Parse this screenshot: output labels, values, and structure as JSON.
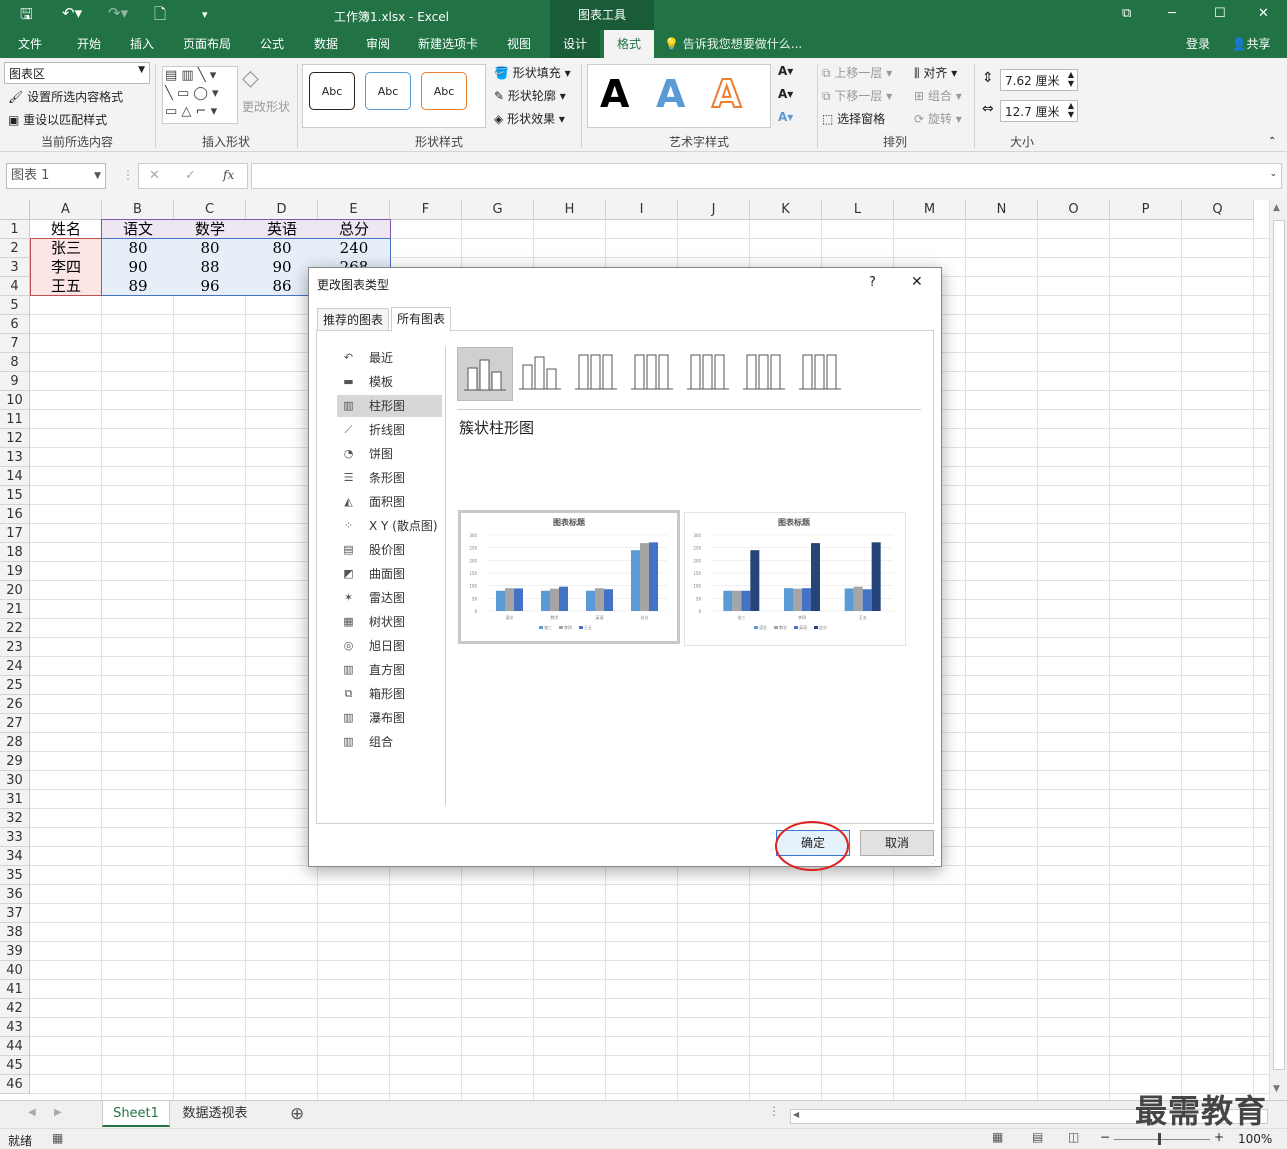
{
  "title_bar": {
    "file_title": "工作簿1.xlsx - Excel",
    "context_tools": "图表工具"
  },
  "tabs": [
    "文件",
    "开始",
    "插入",
    "页面布局",
    "公式",
    "数据",
    "审阅",
    "新建选项卡",
    "视图",
    "设计",
    "格式"
  ],
  "tell_me": "告诉我您想要做什么...",
  "account": {
    "login": "登录",
    "share": "共享"
  },
  "ribbon": {
    "current_selection": {
      "dropdown": "图表区",
      "format_selection": "设置所选内容格式",
      "reset_style": "重设以匹配样式",
      "label": "当前所选内容"
    },
    "insert_shapes": {
      "change_shape": "更改形状",
      "label": "插入形状"
    },
    "shape_styles": {
      "abc": "Abc",
      "fill": "形状填充",
      "outline": "形状轮廓",
      "effects": "形状效果",
      "label": "形状样式"
    },
    "wordart": {
      "letter": "A",
      "label": "艺术字样式"
    },
    "arrange": {
      "bring_forward": "上移一层",
      "send_backward": "下移一层",
      "selection_pane": "选择窗格",
      "align": "对齐",
      "group": "组合",
      "rotate": "旋转",
      "label": "排列"
    },
    "size": {
      "height": "7.62 厘米",
      "width": "12.7 厘米",
      "label": "大小"
    }
  },
  "formula_bar": {
    "name_box": "图表 1",
    "fx": "fx",
    "cancel": "✕",
    "enter": "✓"
  },
  "columns": [
    "A",
    "B",
    "C",
    "D",
    "E",
    "F",
    "G",
    "H",
    "I",
    "J",
    "K",
    "L",
    "M",
    "N",
    "O",
    "P",
    "Q"
  ],
  "rows": [
    "1",
    "2",
    "3",
    "4",
    "5",
    "6",
    "7",
    "8",
    "9",
    "10",
    "11",
    "12",
    "13",
    "14",
    "15",
    "16",
    "17",
    "18",
    "19",
    "20",
    "21",
    "22",
    "23",
    "24",
    "25",
    "26",
    "27",
    "28",
    "29",
    "30",
    "31",
    "32",
    "33",
    "34",
    "35",
    "36",
    "37",
    "38",
    "39",
    "40",
    "41",
    "42",
    "43",
    "44",
    "45",
    "46"
  ],
  "table": [
    [
      "姓名",
      "语文",
      "数学",
      "英语",
      "总分"
    ],
    [
      "张三",
      "80",
      "80",
      "80",
      "240"
    ],
    [
      "李四",
      "90",
      "88",
      "90",
      "268"
    ],
    [
      "王五",
      "89",
      "96",
      "86",
      ""
    ]
  ],
  "sheets": {
    "sheet1": "Sheet1",
    "sheet2": "数据透视表"
  },
  "status": {
    "ready": "就绪",
    "zoom": "100%"
  },
  "dialog": {
    "title": "更改图表类型",
    "help": "?",
    "close": "✕",
    "tabs": {
      "recommended": "推荐的图表",
      "all": "所有图表"
    },
    "categories": [
      "最近",
      "模板",
      "柱形图",
      "折线图",
      "饼图",
      "条形图",
      "面积图",
      "X Y (散点图)",
      "股价图",
      "曲面图",
      "雷达图",
      "树状图",
      "旭日图",
      "直方图",
      "箱形图",
      "瀑布图",
      "组合"
    ],
    "selected_category": "柱形图",
    "subtype_title": "簇状柱形图",
    "ok": "确定",
    "cancel": "取消"
  },
  "chart_data": [
    {
      "type": "bar",
      "title": "图表标题",
      "categories": [
        "语文",
        "数学",
        "英语",
        "总分"
      ],
      "series": [
        {
          "name": "张三",
          "values": [
            80,
            80,
            80,
            240
          ]
        },
        {
          "name": "李四",
          "values": [
            90,
            88,
            90,
            268
          ]
        },
        {
          "name": "王五",
          "values": [
            89,
            96,
            86,
            271
          ]
        }
      ],
      "ylim": [
        0,
        300
      ],
      "ticks": [
        "300",
        "250",
        "200",
        "150",
        "100",
        "50",
        "0"
      ],
      "legend": "bottom",
      "colors": [
        "#5b9bd5",
        "#a5a5a5",
        "#4472c4"
      ]
    },
    {
      "type": "bar",
      "title": "图表标题",
      "categories": [
        "张三",
        "李四",
        "王五"
      ],
      "series": [
        {
          "name": "语文",
          "values": [
            80,
            90,
            89
          ]
        },
        {
          "name": "数学",
          "values": [
            80,
            88,
            96
          ]
        },
        {
          "name": "英语",
          "values": [
            80,
            90,
            86
          ]
        },
        {
          "name": "总分",
          "values": [
            240,
            268,
            271
          ]
        }
      ],
      "ylim": [
        0,
        300
      ],
      "ticks": [
        "300",
        "250",
        "200",
        "150",
        "100",
        "50",
        "0"
      ],
      "legend": "bottom",
      "colors": [
        "#5b9bd5",
        "#a5a5a5",
        "#4472c4",
        "#264478"
      ]
    }
  ],
  "watermark": "最需教育",
  "colors": {
    "excel_green": "#217346",
    "ok_highlight": "#e02020"
  }
}
